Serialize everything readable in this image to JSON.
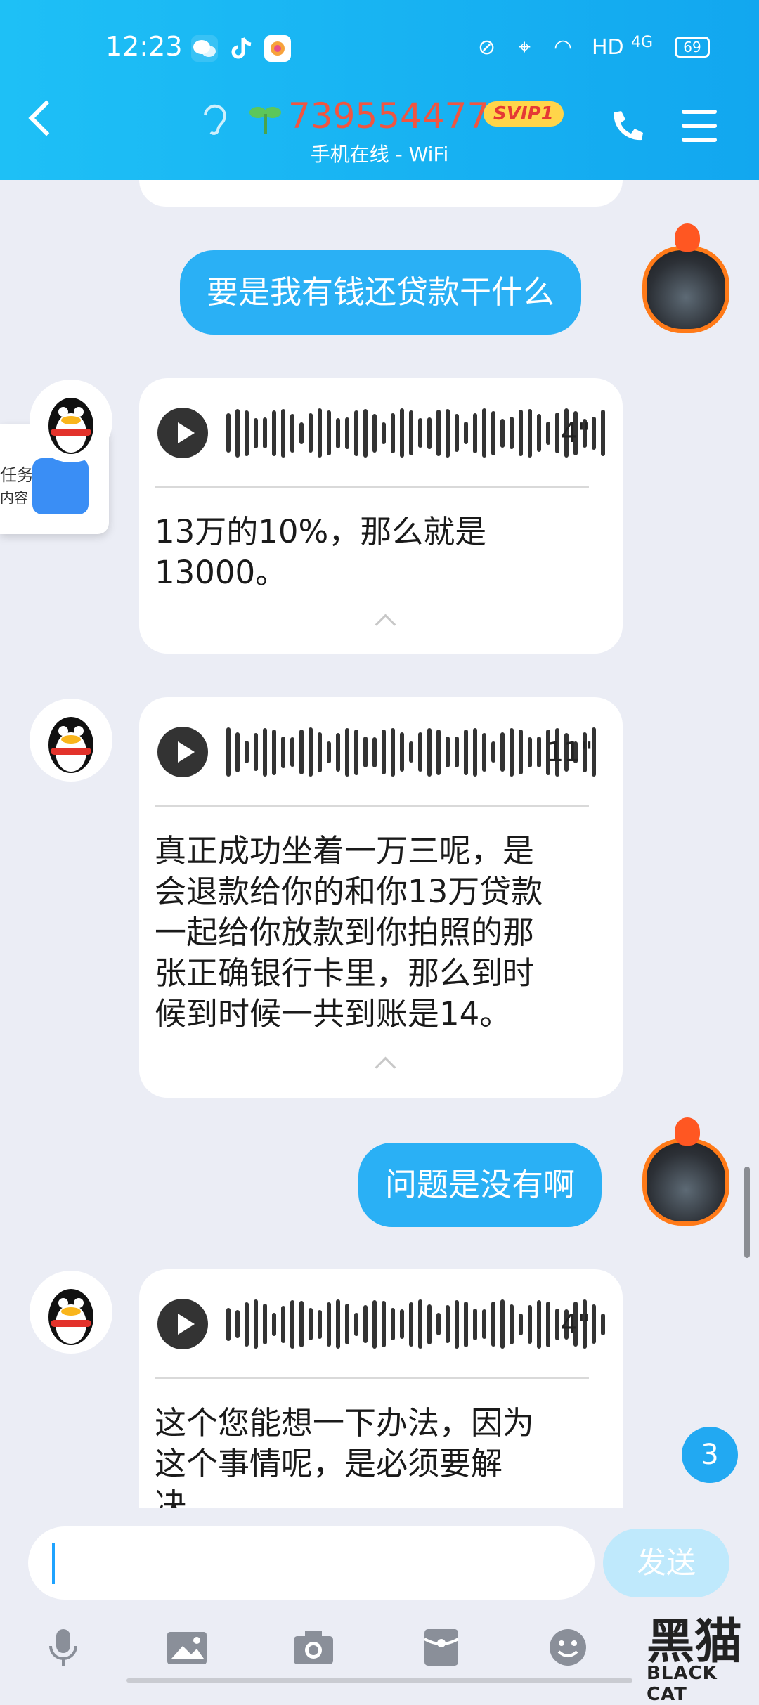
{
  "status_bar": {
    "time": "12:23",
    "network": "HD",
    "signal": "4G",
    "battery": "69"
  },
  "header": {
    "title": "739554477",
    "badge": "SVIP1",
    "subtitle": "手机在线 - WiFi"
  },
  "side_task": {
    "line1": "任务",
    "line2": "内容"
  },
  "messages": [
    {
      "type": "out_text",
      "text": "要是我有钱还贷款干什么"
    },
    {
      "type": "in_voice",
      "duration": "4\"",
      "transcript_line1": "13万的10%，那么就是",
      "transcript_line2": "13000。"
    },
    {
      "type": "in_voice",
      "duration": "11\"",
      "transcript_line1": "真正成功坐着一万三呢，是",
      "transcript_line2": "会退款给你的和你13万贷款",
      "transcript_line3": "一起给你放款到你拍照的那",
      "transcript_line4": "张正确银行卡里，那么到时",
      "transcript_line5": "候到时候一共到账是14。"
    },
    {
      "type": "out_text",
      "text": "问题是没有啊"
    },
    {
      "type": "in_voice",
      "duration": "4\"",
      "transcript_line1": "这个您能想一下办法，因为",
      "transcript_line2": "这个事情呢，是必须要解",
      "transcript_line3": "决"
    }
  ],
  "unread_badge": "3",
  "input": {
    "placeholder": "",
    "send_label": "发送"
  },
  "toolbar": [
    "microphone-icon",
    "image-icon",
    "camera-icon",
    "red-packet-icon",
    "emoji-icon"
  ],
  "watermark": {
    "cn": "黑猫",
    "en": "BLACK CAT"
  }
}
